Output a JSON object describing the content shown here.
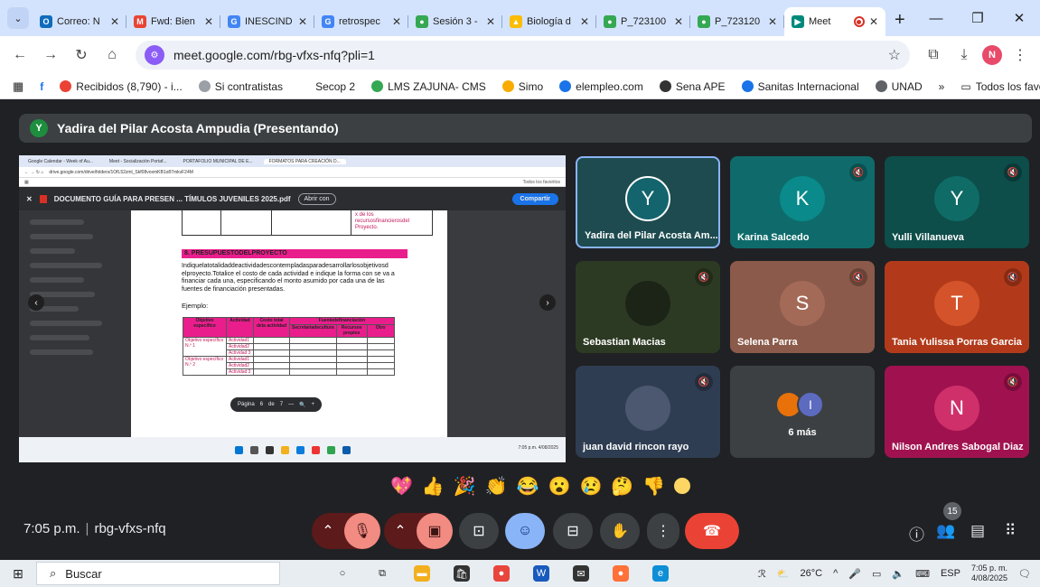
{
  "browser": {
    "tabs": [
      {
        "label": "Correo: N",
        "fav_color": "#0f6cbd",
        "fav": "O"
      },
      {
        "label": "Fwd: Bien",
        "fav_color": "#ea4335",
        "fav": "M"
      },
      {
        "label": "INESCIND",
        "fav_color": "#4285f4",
        "fav": "G"
      },
      {
        "label": "retrospec",
        "fav_color": "#4285f4",
        "fav": "G"
      },
      {
        "label": "Sesión 3 -",
        "fav_color": "#34a853",
        "fav": "●"
      },
      {
        "label": "Biología d",
        "fav_color": "#fbbc04",
        "fav": "▲"
      },
      {
        "label": "P_723100",
        "fav_color": "#34a853",
        "fav": "●"
      },
      {
        "label": "P_723120",
        "fav_color": "#34a853",
        "fav": "●"
      },
      {
        "label": "Meet",
        "fav_color": "#00897b",
        "fav": "▶"
      }
    ],
    "url": "meet.google.com/rbg-vfxs-nfq?pli=1",
    "bookmarks": [
      {
        "label": "Recibidos (8,790) - i...",
        "color": "#ea4335"
      },
      {
        "label": "Si contratistas",
        "color": "#9aa0a6"
      },
      {
        "label": "Secop 2",
        "color": "#ffffff"
      },
      {
        "label": "LMS ZAJUNA- CMS",
        "color": "#34a853"
      },
      {
        "label": "Simo",
        "color": "#f9ab00"
      },
      {
        "label": "elempleo.com",
        "color": "#1a73e8"
      },
      {
        "label": "Sena APE",
        "color": "#333333"
      },
      {
        "label": "Sanitas Internacional",
        "color": "#1a73e8"
      },
      {
        "label": "UNAD",
        "color": "#5f6368"
      }
    ],
    "more_bookmarks": "»",
    "all_favorites": "Todos los favoritos",
    "profile_initial": "N"
  },
  "meet": {
    "presenter": {
      "initial": "Y",
      "label": "Yadira del Pilar Acosta Ampudia (Presentando)"
    },
    "shared_screen": {
      "inner_tabs": [
        "Google Calendar - Week of Au...",
        "Meet - Socialización Portaf...",
        "PORTAFOLIO MUNICIPAL DE E...",
        "FORMATOS PARA CREACIÓN D..."
      ],
      "inner_url": "drive.google.com/drive/folders/1OfL52zml_Skf08voxmKB1o87mkvF24M",
      "inner_bm": "Todos los favoritos",
      "pdf_title": "DOCUMENTO GUÍA PARA PRESEN ... TÍMULOS JUVENILES 2025.pdf",
      "open_with": "Abrir con",
      "share_label": "Compartir",
      "top_cell_text": "x de los recursosfinancierosdel Proyecto.",
      "section_title": "8. PRESUPUESTODELPROYECTO",
      "paragraph": "Indiquelatotalidaddeactividadescontempladasparadesarrollarlosobjetivosd elproyecto.Totalice el costo de cada actividad e indique la forma con se va a financiar cada una, especificando el monto asumido por cada una de las fuentes de financiación presentadas.",
      "ejemplo": "Ejemplo:",
      "table": {
        "h_obj": "Objetivo específico",
        "h_act": "Actividad",
        "h_cost": "Costo total dela actividad",
        "h_fuentes": "Fuentedefinanciación",
        "h_sec": "Secretariadecultura",
        "h_rec": "Recursos propios",
        "h_otro": "Otro",
        "obj1": "Objetivo específico N.º 1",
        "obj2": "Objetivo específico N.º 2",
        "acts": [
          "Actividad1",
          "Actividad2",
          "Actividad 3"
        ]
      },
      "pager": {
        "label": "Página",
        "current": "6",
        "of": "de",
        "total": "7",
        "minus": "—",
        "plus": "+"
      },
      "tray_time": "7:05 p.m.",
      "tray_date": "4/08/2025"
    },
    "tiles": [
      {
        "name": "Yadira del Pilar Acosta Am...",
        "initial": "Y",
        "bg": "#1e4b4f",
        "av": "#13646d",
        "muted": false,
        "speaking": true
      },
      {
        "name": "Karina Salcedo",
        "initial": "K",
        "bg": "#0f6b6b",
        "av": "#0a8a8a",
        "muted": true
      },
      {
        "name": "Yulli Villanueva",
        "initial": "Y",
        "bg": "#0d4d4a",
        "av": "#0f6b66",
        "muted": true
      },
      {
        "name": "Sebastian Macias",
        "initial": "",
        "bg": "#2d3a23",
        "av": "#1c2418",
        "muted": true
      },
      {
        "name": "Selena Parra",
        "initial": "S",
        "bg": "#8b5a4a",
        "av": "#a36a58",
        "muted": true
      },
      {
        "name": "Tania Yulissa Porras Garcia",
        "initial": "T",
        "bg": "#b23a1a",
        "av": "#d4532a",
        "muted": true
      },
      {
        "name": "juan david rincon rayo",
        "initial": "",
        "bg": "#2f3d52",
        "av": "#4b5870",
        "muted": true
      },
      {
        "name": "6 más",
        "initial": "",
        "bg": "#3c4043",
        "av": "#3c4043",
        "muted": false
      },
      {
        "name": "Nilson Andres Sabogal Diaz",
        "initial": "N",
        "bg": "#a0124f",
        "av": "#d0306a",
        "muted": true
      }
    ],
    "more_stack": {
      "a": "",
      "b": "I"
    },
    "reactions": [
      "💖",
      "👍",
      "🎉",
      "👏",
      "😂",
      "😮",
      "😢",
      "🤔",
      "👎"
    ],
    "time": "7:05 p.m.",
    "code": "rbg-vfxs-nfq",
    "people_count": "15"
  },
  "taskbar": {
    "search": "Buscar",
    "weather": "26°C",
    "lang": "ESP",
    "time": "7:05 p. m.",
    "date": "4/08/2025"
  }
}
